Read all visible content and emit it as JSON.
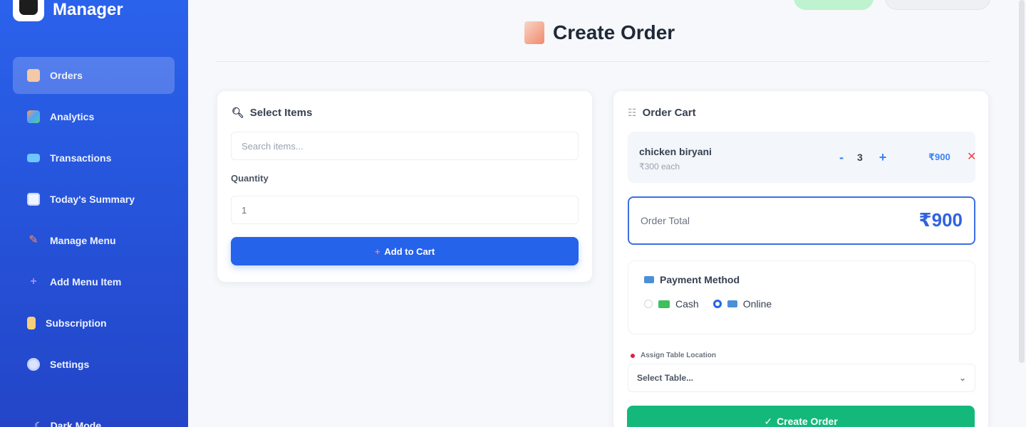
{
  "brand": {
    "name": "Manager"
  },
  "sidebar": {
    "items": [
      {
        "label": "Orders",
        "icon": "clipboard-icon",
        "active": true
      },
      {
        "label": "Analytics",
        "icon": "bar-chart-icon"
      },
      {
        "label": "Transactions",
        "icon": "credit-card-icon"
      },
      {
        "label": "Today's Summary",
        "icon": "calendar-icon"
      },
      {
        "label": "Manage Menu",
        "icon": "pencil-icon"
      },
      {
        "label": "Add Menu Item",
        "icon": "plus-icon"
      },
      {
        "label": "Subscription",
        "icon": "hourglass-icon"
      },
      {
        "label": "Settings",
        "icon": "gear-icon"
      }
    ],
    "dark_mode_label": "Dark Mode"
  },
  "header": {
    "title": "Create Order"
  },
  "select_items": {
    "heading": "Select Items",
    "search_placeholder": "Search items...",
    "quantity_label": "Quantity",
    "quantity_value": "1",
    "add_button": "Add to Cart"
  },
  "cart": {
    "heading": "Order Cart",
    "items": [
      {
        "name": "chicken biryani",
        "price": "₹300 each",
        "qty": "3",
        "line_total": "₹900"
      }
    ],
    "total_label": "Order Total",
    "total_value": "₹900",
    "payment": {
      "title": "Payment Method",
      "options": [
        {
          "label": "Cash",
          "selected": false
        },
        {
          "label": "Online",
          "selected": true
        }
      ]
    },
    "table": {
      "label": "Assign Table Location",
      "placeholder": "Select Table..."
    },
    "create_button": "Create Order"
  },
  "colors": {
    "sidebar": "#2552d8",
    "primary": "#2563eb",
    "success": "#14b87a",
    "danger": "#ef4444"
  }
}
